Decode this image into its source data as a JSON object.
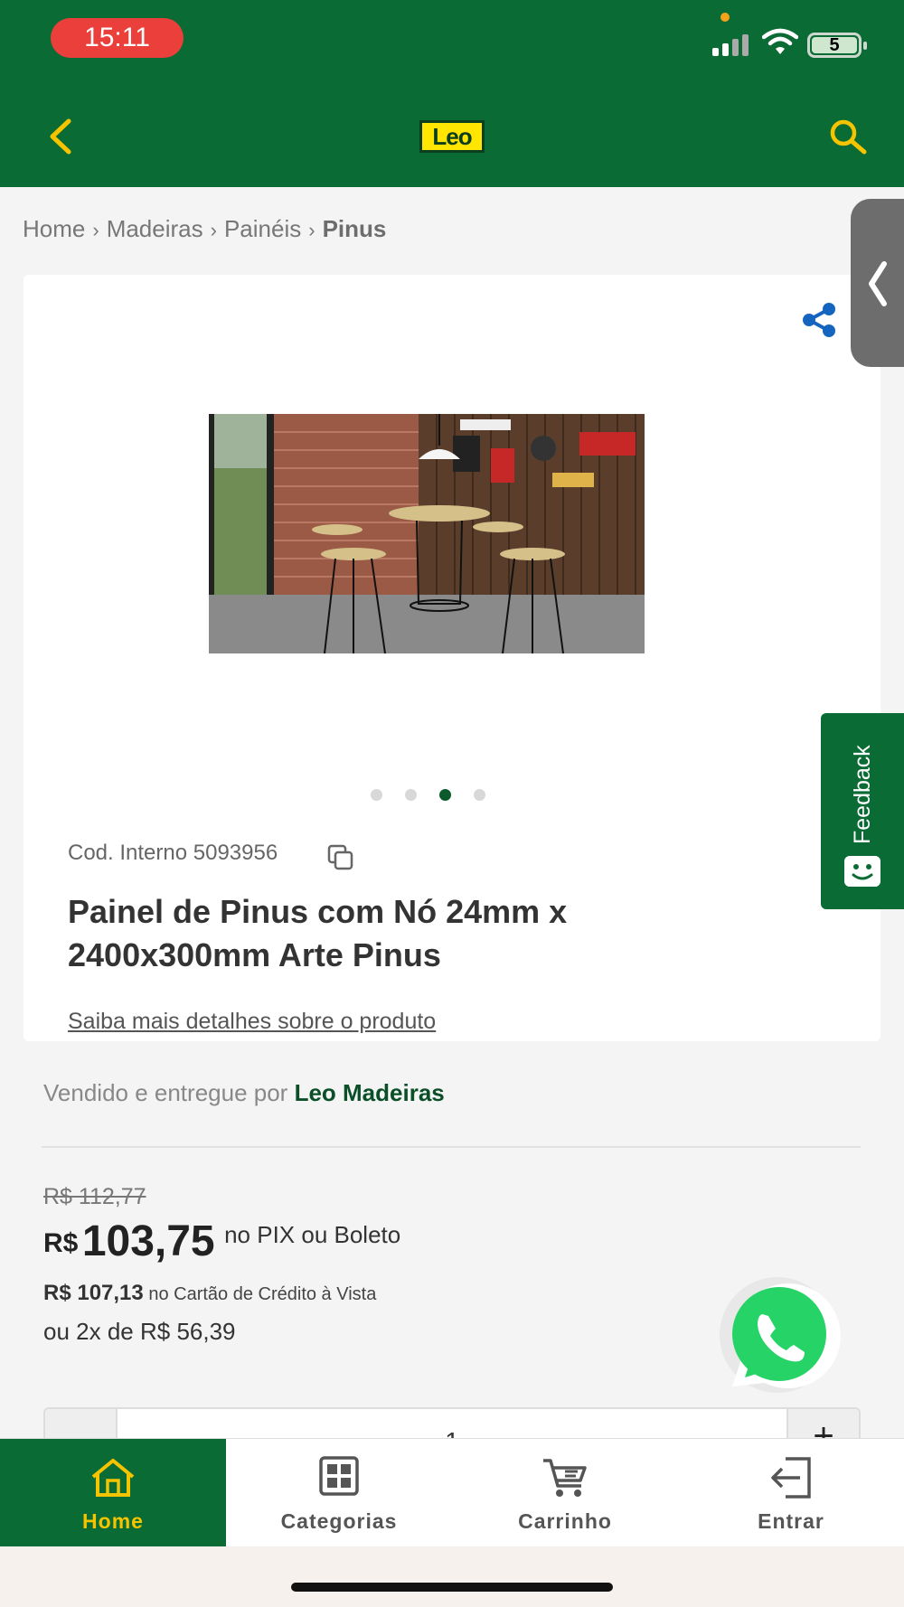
{
  "status_bar": {
    "time": "15:11",
    "battery": "5"
  },
  "header": {
    "logo_text": "Leo",
    "brand_color": "#0b6b34",
    "accent_color": "#f5c400"
  },
  "breadcrumb": {
    "items": [
      "Home",
      "Madeiras",
      "Painéis"
    ],
    "current": "Pinus",
    "separator": "›"
  },
  "product": {
    "image_dots_total": 4,
    "image_dots_active": 3,
    "code": "Cod. Interno 5093956",
    "title": "Painel de Pinus com Nó 24mm x 2400x300mm Arte Pinus",
    "details_link": "Saiba mais detalhes sobre o produto"
  },
  "feedback": {
    "label": "Feedback"
  },
  "seller": {
    "prefix": "Vendido e entregue por",
    "name": "Leo Madeiras"
  },
  "pricing": {
    "old_price": "R$ 112,77",
    "currency": "R$",
    "price": "103,75",
    "price_note": "no PIX ou Boleto",
    "card_price": "R$ 107,13",
    "card_note": "no Cartão de Crédito à Vista",
    "installment_prefix": "ou 2x de",
    "installment_value": "R$ 56,39"
  },
  "quantity": {
    "value": "1",
    "plus": "+"
  },
  "bottom_nav": {
    "home": "Home",
    "categories": "Categorias",
    "cart": "Carrinho",
    "login": "Entrar"
  }
}
